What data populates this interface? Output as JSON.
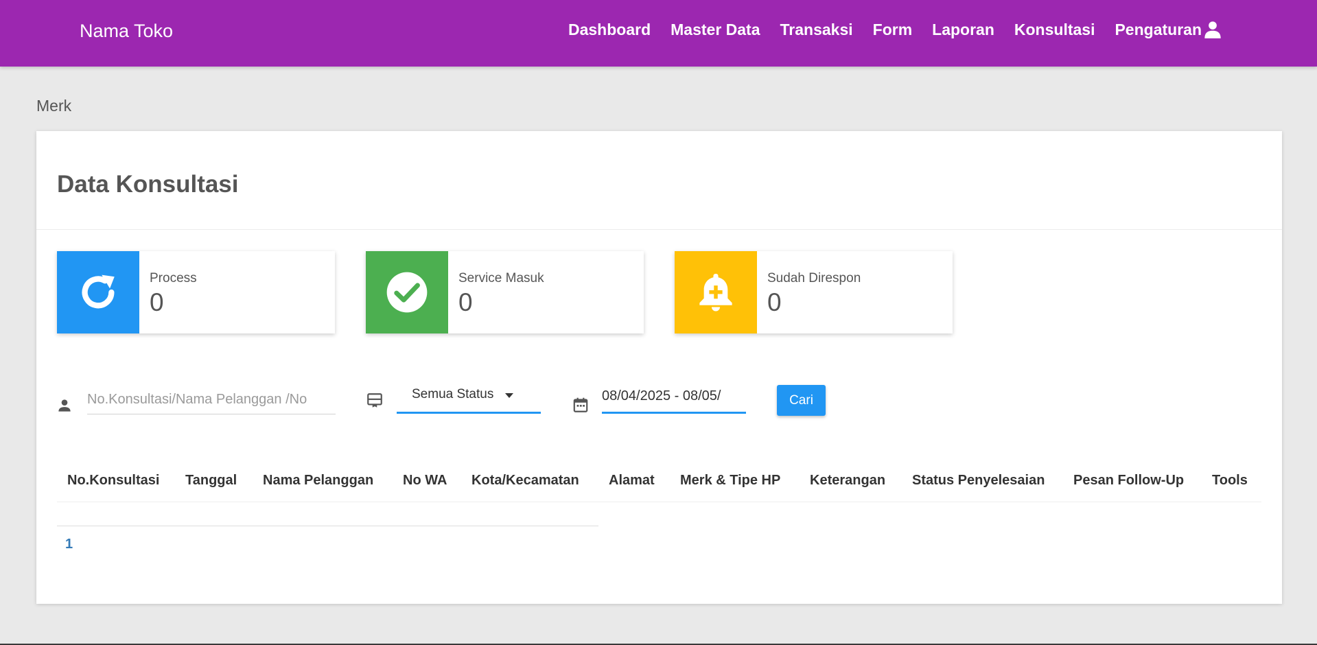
{
  "navbar": {
    "brand": "Nama Toko",
    "links": [
      "Dashboard",
      "Master Data",
      "Transaksi",
      "Form",
      "Laporan",
      "Konsultasi",
      "Pengaturan"
    ],
    "user_icon": "user-icon",
    "background_color": "#9c27b0"
  },
  "page": {
    "heading": "Merk"
  },
  "card": {
    "title": "Data Konsultasi",
    "info_boxes": [
      {
        "label": "Process",
        "value": "0",
        "icon": "refresh-icon",
        "color": "#2196f3"
      },
      {
        "label": "Service Masuk",
        "value": "0",
        "icon": "check-circle-icon",
        "color": "#4caf50"
      },
      {
        "label": "Sudah Direspon",
        "value": "0",
        "icon": "bell-plus-icon",
        "color": "#ffc107"
      }
    ]
  },
  "filters": {
    "search": {
      "placeholder": "No.Konsultasi/Nama Pelanggan /No",
      "value": "",
      "icon": "person-icon"
    },
    "status": {
      "selected": "Semua Status",
      "icon": "card-icon"
    },
    "date": {
      "value": "08/04/2025 - 08/05/",
      "icon": "calendar-icon"
    },
    "search_button": "Cari"
  },
  "table": {
    "headers": [
      "No.Konsultasi",
      "Tanggal",
      "Nama Pelanggan",
      "No WA",
      "Kota/Kecamatan",
      "Alamat",
      "Merk & Tipe HP",
      "Keterangan",
      "Status Penyelesaian",
      "Pesan Follow-Up",
      "Tools"
    ],
    "rows": []
  },
  "pagination": {
    "pages": [
      "1"
    ],
    "current": "1"
  }
}
